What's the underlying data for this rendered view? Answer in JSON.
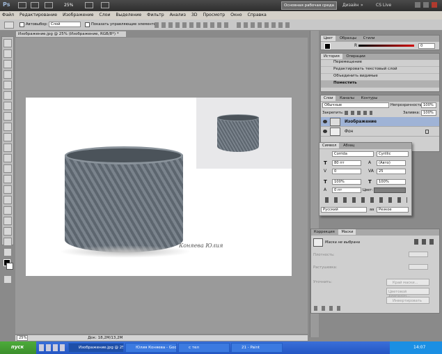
{
  "app": {
    "logo": "Ps",
    "zoom": "25%",
    "workspace_button": "Основная рабочая среда",
    "design_label": "Дизайн",
    "cs_live": "CS Live"
  },
  "menubar": [
    "Файл",
    "Редактирование",
    "Изображение",
    "Слои",
    "Выделение",
    "Фильтр",
    "Анализ",
    "3D",
    "Просмотр",
    "Окно",
    "Справка"
  ],
  "options": {
    "autoselect_label": "Автовыбор:",
    "autoselect_value": "Слой",
    "show_controls_label": "Показать управляющие элементы"
  },
  "document": {
    "tab_title": "Изображение.jpg @ 25% (Изображение, RGB/8*) *",
    "signature": "Коняева Юлия",
    "status_zoom": "25%",
    "status_doc": "Док: 18,2M/13,2M"
  },
  "color_panel": {
    "tabs": [
      "Цвет",
      "Образцы",
      "Стили"
    ],
    "r_label": "R",
    "r_value": "0"
  },
  "history_panel": {
    "tabs": [
      "История",
      "Операции"
    ],
    "items": [
      "Перемещение",
      "Редактировать текстовый слой",
      "Объединить видимые",
      "Поместить"
    ]
  },
  "layers_panel": {
    "tabs": [
      "Слои",
      "Каналы",
      "Контуры"
    ],
    "blend_mode": "Обычные",
    "opacity_label": "Непрозрачность:",
    "opacity_value": "100%",
    "lock_label": "Закрепить:",
    "fill_label": "Заливка:",
    "fill_value": "100%",
    "layers": [
      "Изображение",
      "Фон"
    ]
  },
  "character_panel": {
    "tabs": [
      "Символ",
      "Абзац"
    ],
    "font": "Corrida",
    "script": "Cyrillic",
    "size": "80 пт",
    "leading": "(Авто)",
    "kerning": "0",
    "tracking": "25",
    "vscale": "100%",
    "hscale": "100%",
    "baseline": "0 пт",
    "color_label": "Цвет:",
    "language": "Русский",
    "antialias": "Резкое",
    "aa_label": "аa"
  },
  "masks_panel": {
    "tabs": [
      "Коррекция",
      "Маски"
    ],
    "no_mask": "Маска не выбрана",
    "density_label": "Плотность:",
    "feather_label": "Растушевка:",
    "refine_label": "Уточнить:",
    "edge_button": "Край маски...",
    "color_range_button": "Цветовой диапазон...",
    "invert_button": "Инвертировать"
  },
  "taskbar": {
    "start": "пуск",
    "tasks": [
      "Изображение.jpg @ 25...",
      "Юлия Коняева - Goo...",
      "с тел",
      "21 - Paint"
    ],
    "time": "14:07"
  },
  "colors": {
    "accent_blue": "#2456c4",
    "start_green": "#3c8f2c",
    "workspace_bg": "#9a9a9a"
  }
}
